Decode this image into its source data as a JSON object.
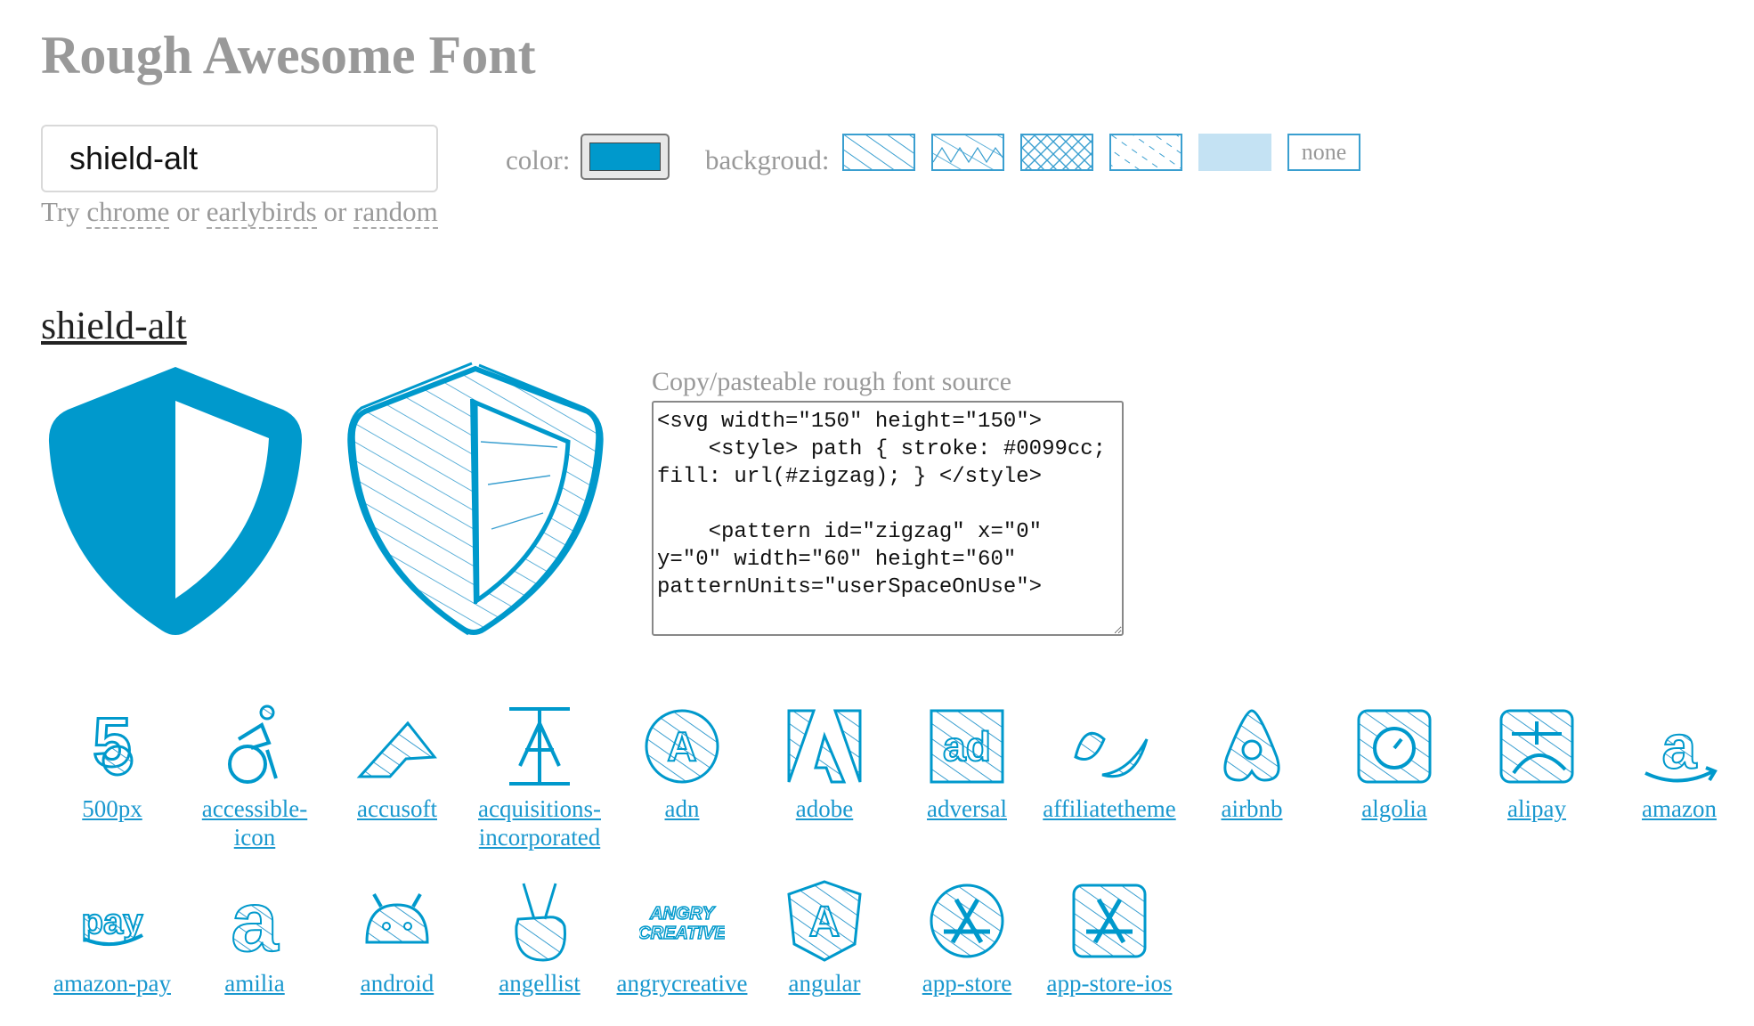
{
  "page": {
    "title": "Rough Awesome Font"
  },
  "search": {
    "value": "shield-alt"
  },
  "hint": {
    "prefix": "Try",
    "or1": "or",
    "or2": "or",
    "links": [
      "chrome",
      "earlybirds",
      "random"
    ]
  },
  "controls": {
    "color_label": "color:",
    "color_value": "#0099cc",
    "background_label": "backgroud:",
    "background_none": "none",
    "background_options": [
      "hachure",
      "zigzag",
      "cross-hatch",
      "dashed",
      "solid",
      "none"
    ]
  },
  "current_icon": {
    "name": "shield-alt",
    "source_label": "Copy/pasteable rough font source",
    "source": "<svg width=\"150\" height=\"150\">\n    <style> path { stroke: #0099cc; fill: url(#zigzag); } </style>\n\n    <pattern id=\"zigzag\" x=\"0\" y=\"0\" width=\"60\" height=\"60\" patternUnits=\"userSpaceOnUse\">"
  },
  "icons": [
    {
      "name": "500px",
      "icon": "500px-icon"
    },
    {
      "name": "accessible-icon",
      "icon": "accessible-icon"
    },
    {
      "name": "accusoft",
      "icon": "accusoft-icon"
    },
    {
      "name": "acquisitions-incorporated",
      "icon": "acquisitions-incorporated-icon"
    },
    {
      "name": "adn",
      "icon": "adn-icon"
    },
    {
      "name": "adobe",
      "icon": "adobe-icon"
    },
    {
      "name": "adversal",
      "icon": "adversal-icon"
    },
    {
      "name": "affiliatetheme",
      "icon": "affiliatetheme-icon"
    },
    {
      "name": "airbnb",
      "icon": "airbnb-icon"
    },
    {
      "name": "algolia",
      "icon": "algolia-icon"
    },
    {
      "name": "alipay",
      "icon": "alipay-icon"
    },
    {
      "name": "amazon",
      "icon": "amazon-icon"
    },
    {
      "name": "amazon-pay",
      "icon": "amazon-pay-icon"
    },
    {
      "name": "amilia",
      "icon": "amilia-icon"
    },
    {
      "name": "android",
      "icon": "android-icon"
    },
    {
      "name": "angellist",
      "icon": "angellist-icon"
    },
    {
      "name": "angrycreative",
      "icon": "angrycreative-icon"
    },
    {
      "name": "angular",
      "icon": "angular-icon"
    },
    {
      "name": "app-store",
      "icon": "app-store-icon"
    },
    {
      "name": "app-store-ios",
      "icon": "app-store-ios-icon"
    }
  ],
  "icon_art": {
    "adversal": "ad",
    "amazon-pay": "pay",
    "amilia": "a",
    "amazon": "a",
    "angrycreative": "ANGRY CREATIVE",
    "adn": "A",
    "angular": "A"
  }
}
